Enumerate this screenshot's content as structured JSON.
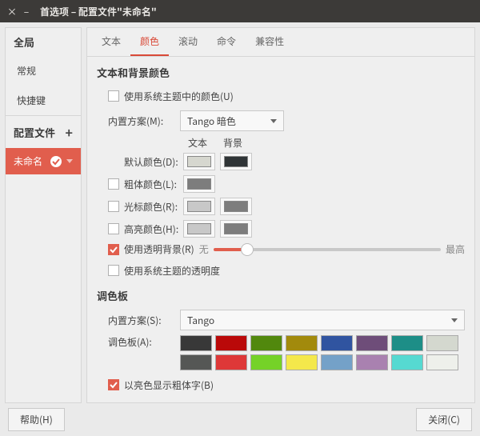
{
  "window": {
    "title": "首选项 – 配置文件\"未命名\""
  },
  "sidebar": {
    "header_global": "全局",
    "items_global": [
      "常规",
      "快捷键"
    ],
    "header_profiles": "配置文件",
    "profile_active": "未命名"
  },
  "tabs": [
    "文本",
    "颜色",
    "滚动",
    "命令",
    "兼容性"
  ],
  "active_tab_index": 1,
  "colors": {
    "section_title": "文本和背景颜色",
    "use_theme_colors": "使用系统主题中的颜色(U)",
    "builtin_scheme_label": "内置方案(M):",
    "builtin_scheme_value": "Tango 暗色",
    "col_text": "文本",
    "col_bg": "背景",
    "default_color_label": "默认颜色(D):",
    "default_text": "#d6d7cf",
    "default_bg": "#2f3436",
    "bold_color_label": "粗体颜色(L):",
    "bold_color": "#7d7d7d",
    "cursor_color_label": "光标颜色(R):",
    "cursor_text": "#c8c8c8",
    "cursor_bg": "#7d7d7d",
    "highlight_color_label": "高亮颜色(H):",
    "highlight_text": "#c8c8c8",
    "highlight_bg": "#7d7d7d",
    "transparent_bg_label": "使用透明背景(R)",
    "transparent_min": "无",
    "transparent_max": "最高",
    "transparent_pct": 15,
    "use_theme_transparency": "使用系统主题的透明度"
  },
  "palette_section": {
    "title": "调色板",
    "builtin_label": "内置方案(S):",
    "builtin_value": "Tango",
    "palette_label": "调色板(A):",
    "colors": [
      "#383838",
      "#ba0909",
      "#51880d",
      "#a28a0c",
      "#3054a0",
      "#6e4d79",
      "#1d8e87",
      "#d4d8cf",
      "#555755",
      "#de3838",
      "#75d228",
      "#f4e84b",
      "#74a1c8",
      "#a981b0",
      "#56d9d1",
      "#eef0eb"
    ],
    "bold_bright_label": "以亮色显示粗体字(B)"
  },
  "footer": {
    "help": "帮助(H)",
    "close": "关闭(C)"
  }
}
